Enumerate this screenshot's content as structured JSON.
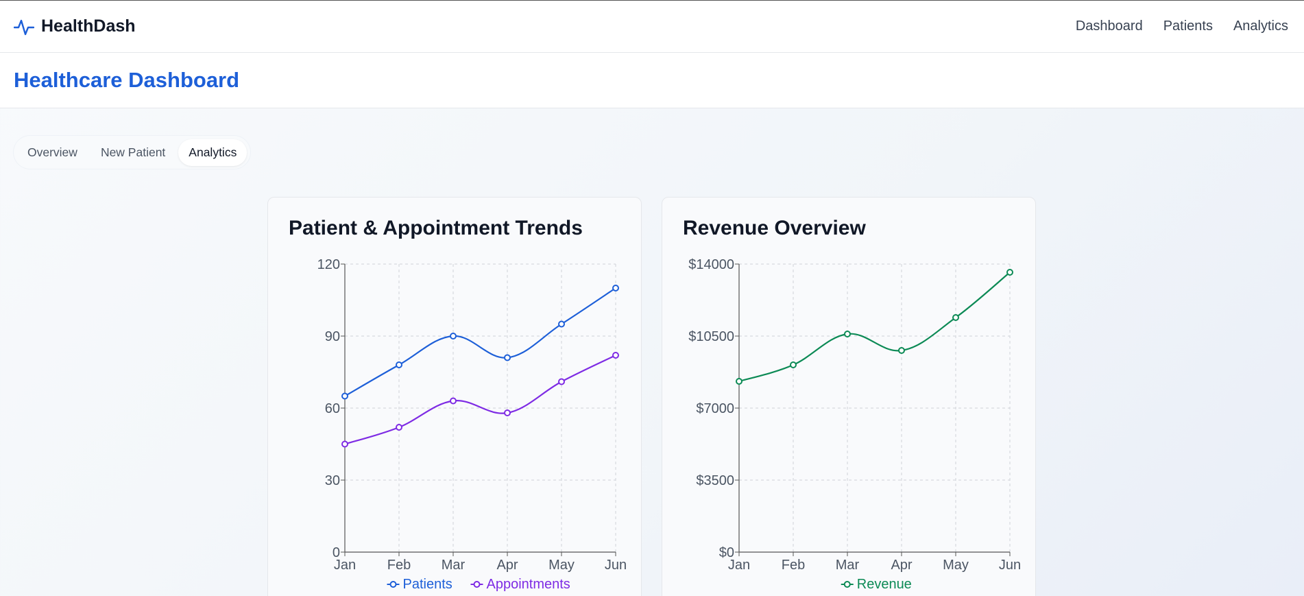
{
  "app": {
    "name": "HealthDash",
    "nav": [
      "Dashboard",
      "Patients",
      "Analytics"
    ]
  },
  "page": {
    "title": "Healthcare Dashboard",
    "tabs": [
      "Overview",
      "New Patient",
      "Analytics"
    ],
    "active_tab": "Analytics"
  },
  "colors": {
    "brand": "#1d5fd8",
    "patients": "#1d5fd8",
    "appointments": "#7e2be4",
    "revenue": "#0c8a55"
  },
  "icons": {
    "brand": "activity-pulse-icon"
  },
  "chart_data": [
    {
      "type": "line",
      "title": "Patient & Appointment Trends",
      "categories": [
        "Jan",
        "Feb",
        "Mar",
        "Apr",
        "May",
        "Jun"
      ],
      "series": [
        {
          "name": "Patients",
          "values": [
            65,
            78,
            90,
            81,
            95,
            110
          ],
          "color": "#1d5fd8"
        },
        {
          "name": "Appointments",
          "values": [
            45,
            52,
            63,
            58,
            71,
            82
          ],
          "color": "#7e2be4"
        }
      ],
      "yticks": [
        "0",
        "30",
        "60",
        "90",
        "120"
      ],
      "ylim": [
        0,
        120
      ],
      "grid": true,
      "legend": "bottom"
    },
    {
      "type": "line",
      "title": "Revenue Overview",
      "categories": [
        "Jan",
        "Feb",
        "Mar",
        "Apr",
        "May",
        "Jun"
      ],
      "series": [
        {
          "name": "Revenue",
          "values": [
            8300,
            9100,
            10600,
            9800,
            11400,
            13600
          ],
          "color": "#0c8a55"
        }
      ],
      "yticks": [
        "$0",
        "$3500",
        "$7000",
        "$10500",
        "$14000"
      ],
      "ylim": [
        0,
        14000
      ],
      "grid": true,
      "legend": "bottom"
    }
  ]
}
